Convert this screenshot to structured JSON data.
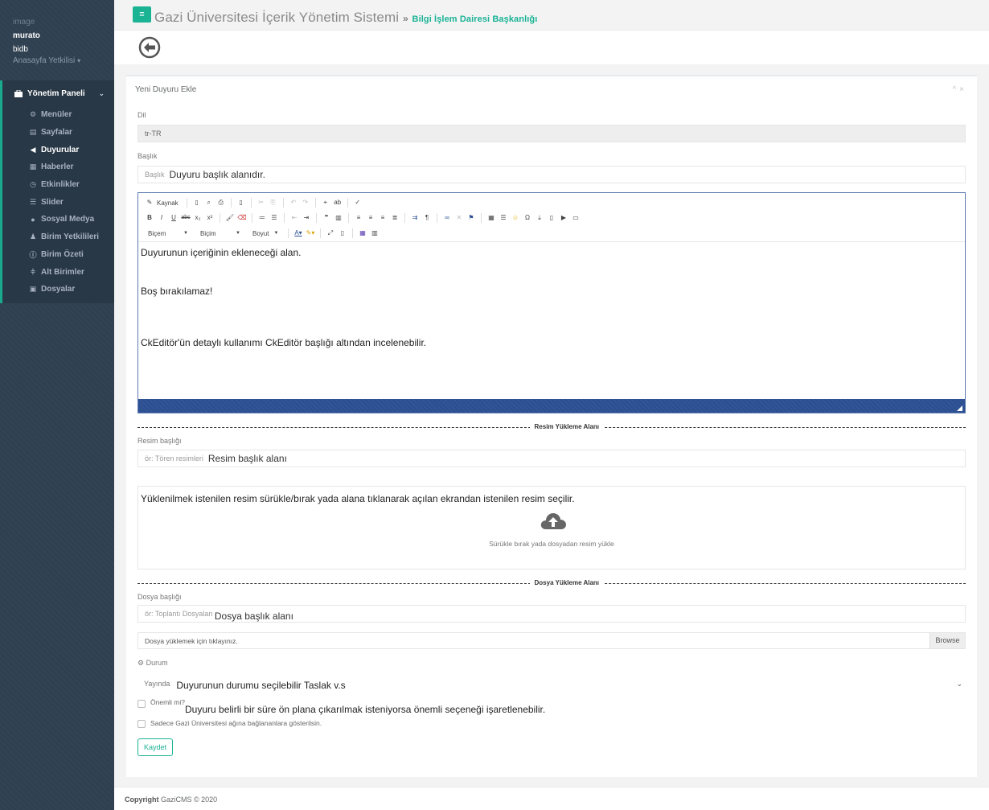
{
  "profile": {
    "image_alt": "image",
    "username": "murato",
    "unit": "bidb",
    "role": "Anasayfa Yetkilisi"
  },
  "nav": {
    "header": "Yönetim Paneli",
    "items": [
      {
        "label": "Menüler",
        "icon": "gear-icon",
        "active": false
      },
      {
        "label": "Sayfalar",
        "icon": "pages-icon",
        "active": false
      },
      {
        "label": "Duyurular",
        "icon": "bullhorn-icon",
        "active": true
      },
      {
        "label": "Haberler",
        "icon": "newspaper-icon",
        "active": false
      },
      {
        "label": "Etkinlikler",
        "icon": "clock-icon",
        "active": false
      },
      {
        "label": "Slider",
        "icon": "sliders-icon",
        "active": false
      },
      {
        "label": "Sosyal Medya",
        "icon": "globe-icon",
        "active": false
      },
      {
        "label": "Birim Yetkilileri",
        "icon": "user-icon",
        "active": false
      },
      {
        "label": "Birim Özeti",
        "icon": "info-icon",
        "active": false
      },
      {
        "label": "Alt Birimler",
        "icon": "sitemap-icon",
        "active": false
      },
      {
        "label": "Dosyalar",
        "icon": "briefcase-icon",
        "active": false
      }
    ]
  },
  "header": {
    "menu_icon": "≡",
    "title": "Gazi Üniversitesi İçerik Yönetim Sistemi",
    "separator": "»",
    "department": "Bilgi İşlem Dairesi Başkanlığı"
  },
  "card": {
    "title": "Yeni Duyuru Ekle",
    "collapse": "^",
    "close": "×"
  },
  "form": {
    "language_label": "Dil",
    "language_value": "tr-TR",
    "title_label": "Başlık",
    "title_placeholder": "Başlık",
    "title_note": "Duyuru başlık alanıdır.",
    "editor": {
      "source_label": "Kaynak",
      "format1": "Biçem",
      "format2": "Biçim",
      "size": "Boyut",
      "content_lines": [
        "Duyurunun içeriğinin ekleneceği alan.",
        "Boş bırakılamaz!",
        "CkEditör'ün detaylı kullanımı CkEditör başlığı altından incelenebilir."
      ]
    },
    "image_section": "Resim Yükleme Alanı",
    "image_title_label": "Resim başlığı",
    "image_title_placeholder": "ör: Tören resimleri",
    "image_title_note": "Resim başlık alanı",
    "dropzone_note": "Yüklenilmek istenilen resim sürükle/bırak yada alana tıklanarak açılan ekrandan istenilen resim seçilir.",
    "dropzone_text": "Sürükle bırak yada dosyadan resim yükle",
    "file_section": "Dosya Yükleme Alanı",
    "file_title_label": "Dosya başlığı",
    "file_title_placeholder": "ör: Toplantı Dosyaları",
    "file_title_note": "Dosya başlık alanı",
    "file_input_text": "Dosya yüklemek için tıklayınız.",
    "browse_label": "Browse",
    "status_label": "Durum",
    "status_value": "Yayında",
    "status_note": "Duyurunun durumu seçilebilir Taslak v.s",
    "important_label": "Önemli mi?",
    "important_note": "Duyuru belirli bir süre ön plana çıkarılmak isteniyorsa önemli seçeneği işaretlenebilir.",
    "gazi_only_label": "Sadece Gazi Üniversitesi ağına bağlananlara gösterilsin.",
    "save_label": "Kaydet"
  },
  "footer": {
    "copyright": "Copyright",
    "text": "GaziCMS © 2020"
  },
  "colors": {
    "accent": "#1ab394",
    "sidebar": "#2f4050",
    "editor_footer": "#2a4e91"
  }
}
